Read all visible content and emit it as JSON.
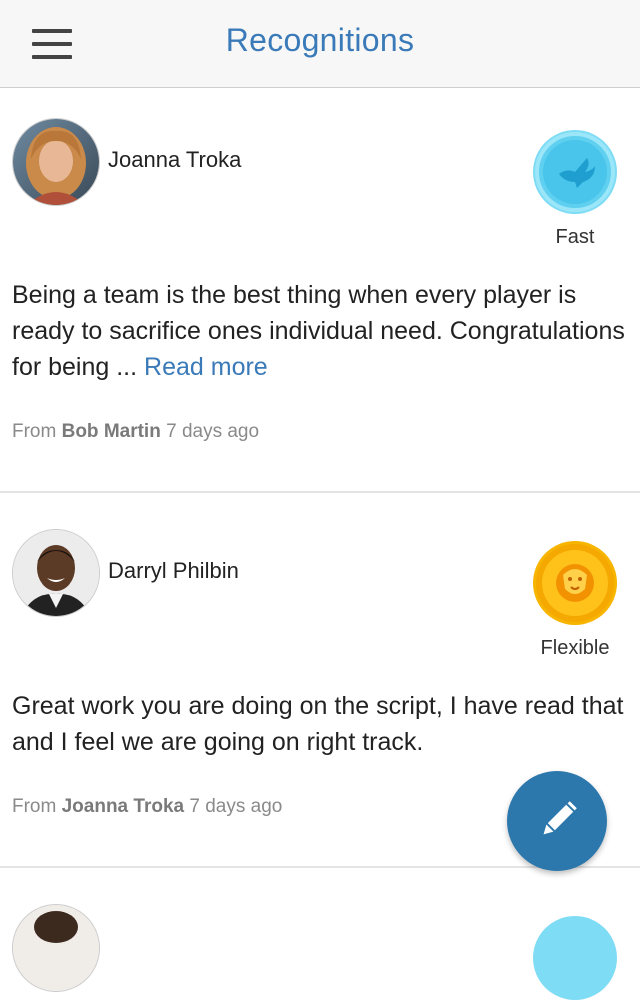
{
  "header": {
    "title": "Recognitions",
    "menu_icon": "hamburger-menu-icon"
  },
  "recognitions": [
    {
      "name": "Joanna Troka",
      "badge_label": "Fast",
      "badge_icon": "dove-icon",
      "badge_color": "#5fd0f0",
      "message": "Being a team is the best thing when every player is ready to sacrifice ones individual need. Congratulations for being ... ",
      "read_more": "Read more",
      "from_prefix": "From ",
      "from_name": "Bob Martin",
      "time": " 7 days ago"
    },
    {
      "name": "Darryl Philbin",
      "badge_label": "Flexible",
      "badge_icon": "lion-icon",
      "badge_color": "#f7b500",
      "message": "Great work you are doing on the script, I have read that and I feel we are going on right track.",
      "from_prefix": "From ",
      "from_name": "Joanna Troka",
      "time": " 7 days ago"
    }
  ],
  "fab": {
    "icon": "pencil-icon",
    "color": "#2c78ad"
  },
  "colors": {
    "accent": "#3a7ab8",
    "header_bg": "#f7f7f7"
  }
}
